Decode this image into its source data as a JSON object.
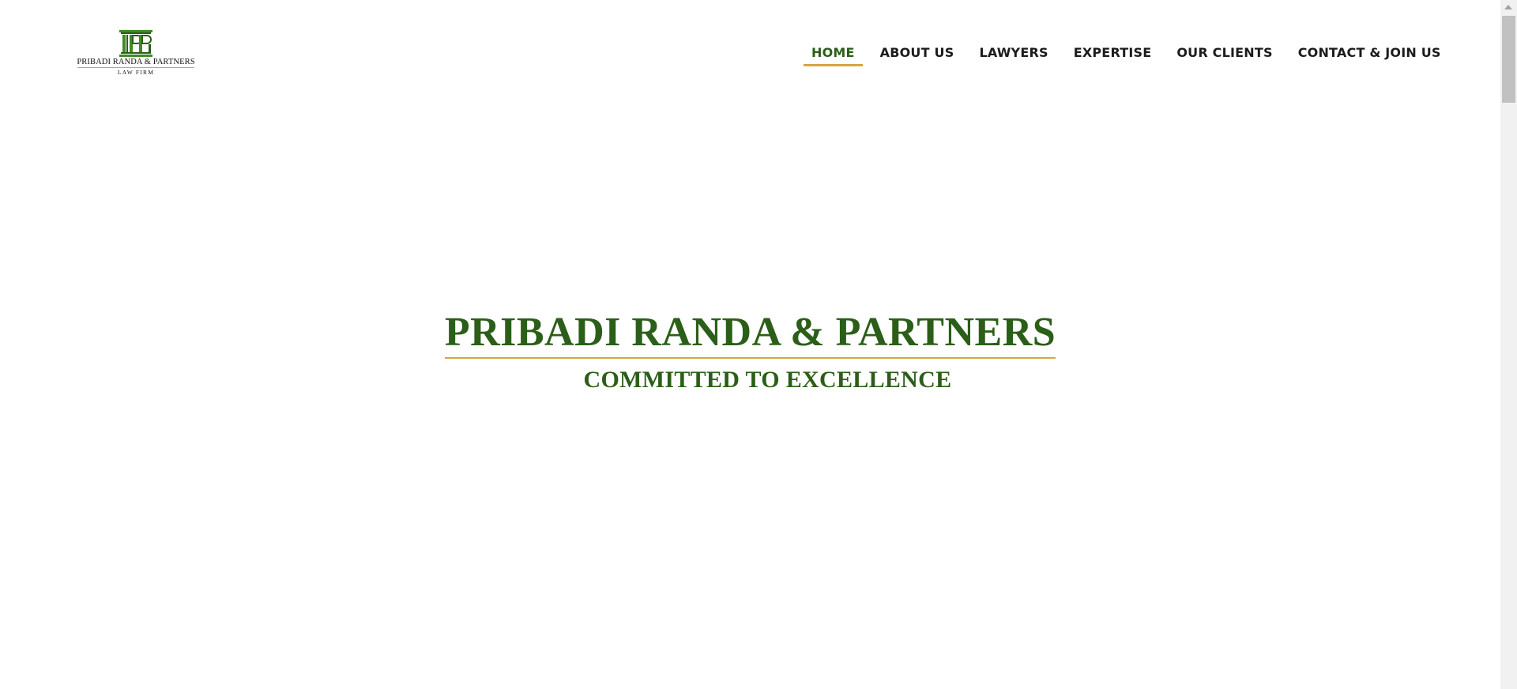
{
  "logo": {
    "name": "PRIBADI RANDA & PARTNERS",
    "sub": "LAW FIRM",
    "mark_color": "#3f8a26"
  },
  "nav": {
    "items": [
      {
        "label": "HOME",
        "active": true
      },
      {
        "label": "ABOUT US",
        "active": false
      },
      {
        "label": "LAWYERS",
        "active": false
      },
      {
        "label": "EXPERTISE",
        "active": false
      },
      {
        "label": "OUR CLIENTS",
        "active": false
      },
      {
        "label": "CONTACT & JOIN US",
        "active": false
      }
    ]
  },
  "hero": {
    "title": "PRIBADI RANDA & PARTNERS",
    "subtitle": "COMMITTED TO EXCELLENCE"
  },
  "colors": {
    "brand_green": "#2b5e18",
    "accent_gold": "#d9a441"
  }
}
